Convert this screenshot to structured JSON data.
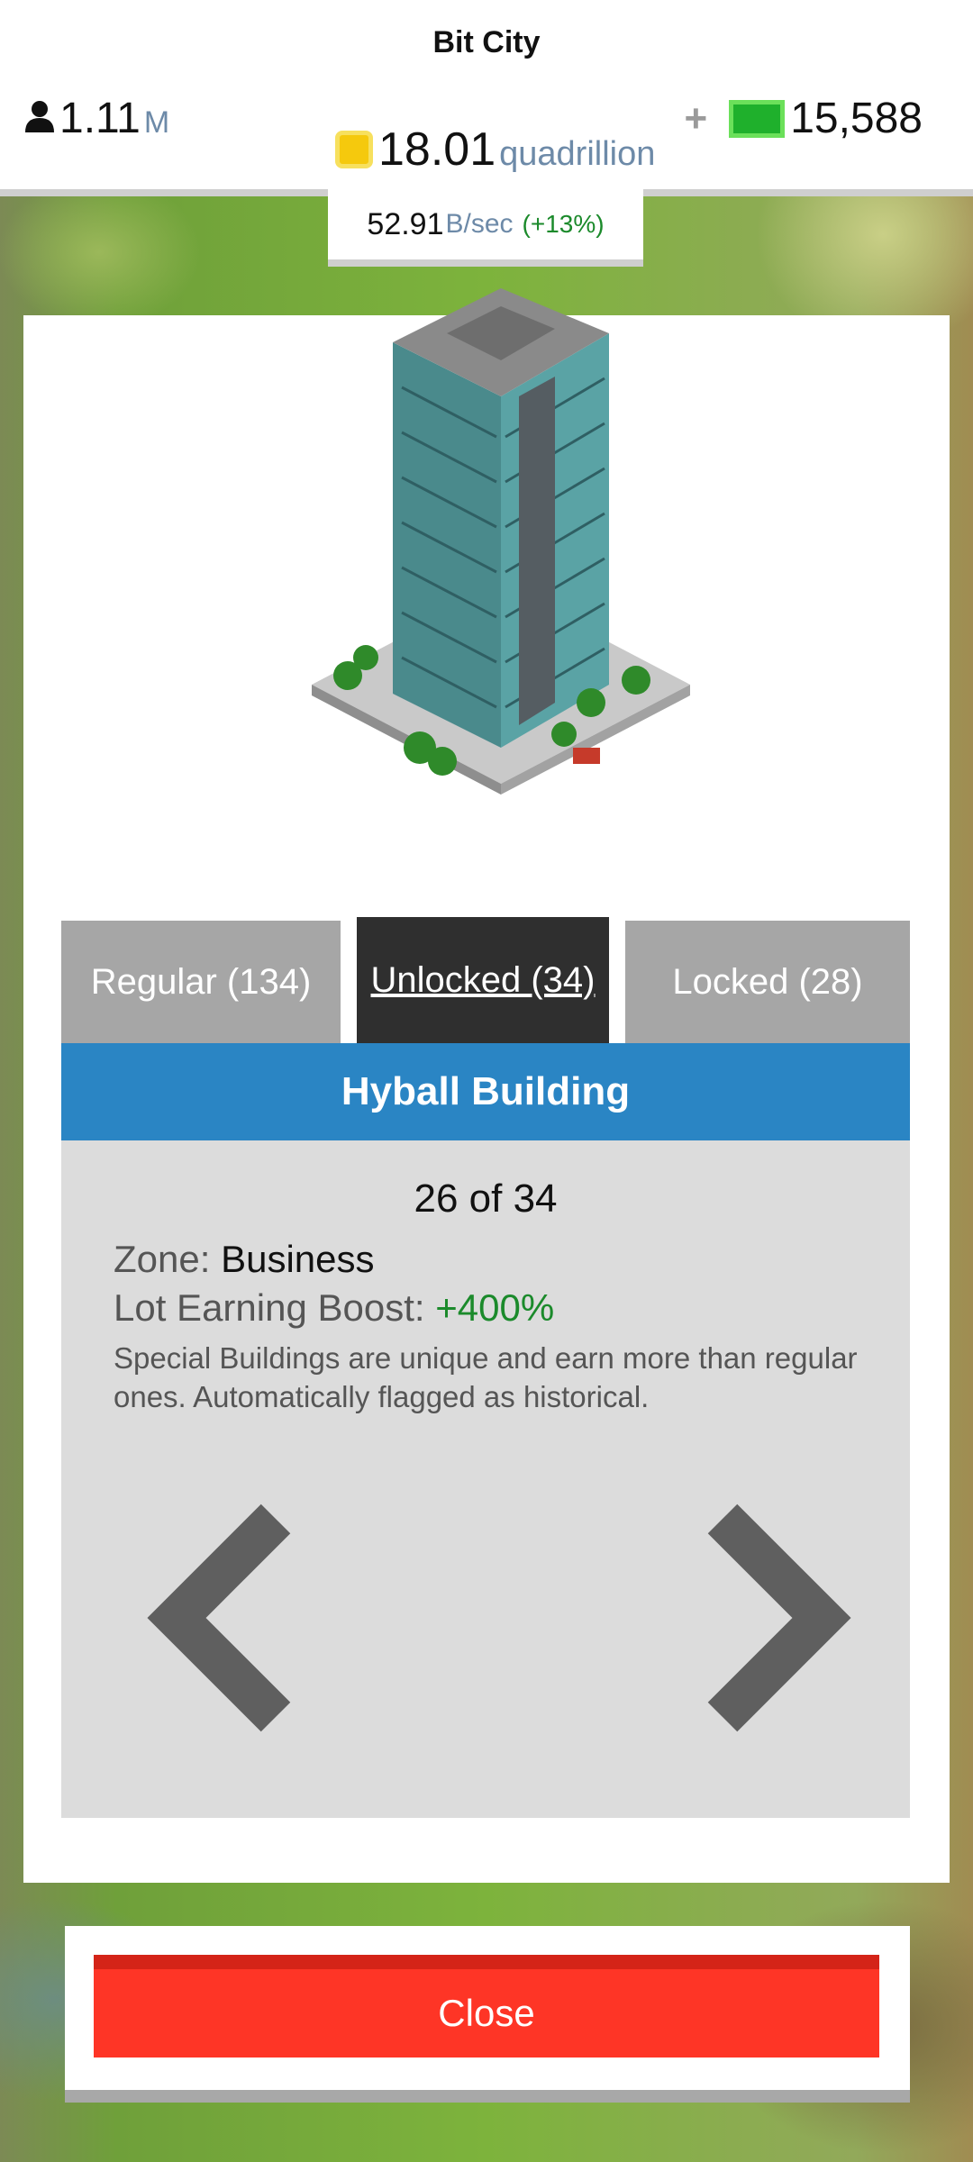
{
  "header": {
    "city_name": "Bit City",
    "population": {
      "value": "1.11",
      "unit": "M",
      "icon": "person-icon"
    },
    "coins": {
      "value": "18.01",
      "unit": "quadrillion",
      "icon": "coin-icon"
    },
    "bucks": {
      "plus": "+",
      "value": "15,588",
      "icon": "bill-icon"
    },
    "income": {
      "value": "52.91",
      "unit": "B/sec",
      "change": "(+13%)"
    }
  },
  "tabs": [
    {
      "label": "Regular (134)",
      "active": false
    },
    {
      "label": "Unlocked (34)",
      "active": true
    },
    {
      "label": "Locked (28)",
      "active": false
    }
  ],
  "building": {
    "name": "Hyball Building",
    "counter": "26 of 34",
    "zone_label": "Zone: ",
    "zone_value": "Business",
    "boost_label": "Lot Earning Boost: ",
    "boost_value": "+400%",
    "description": "Special Buildings are unique and earn more than regular ones. Automatically flagged as historical."
  },
  "nav": {
    "prev_icon": "chevron-left-icon",
    "next_icon": "chevron-right-icon"
  },
  "close_label": "Close",
  "colors": {
    "title_bar": "#2a85c4",
    "active_tab": "#2f2f2f",
    "inactive_tab": "#a6a6a6",
    "close_button": "#fe3526",
    "positive": "#1b8a2b",
    "unit_text": "#6d8aa8"
  }
}
